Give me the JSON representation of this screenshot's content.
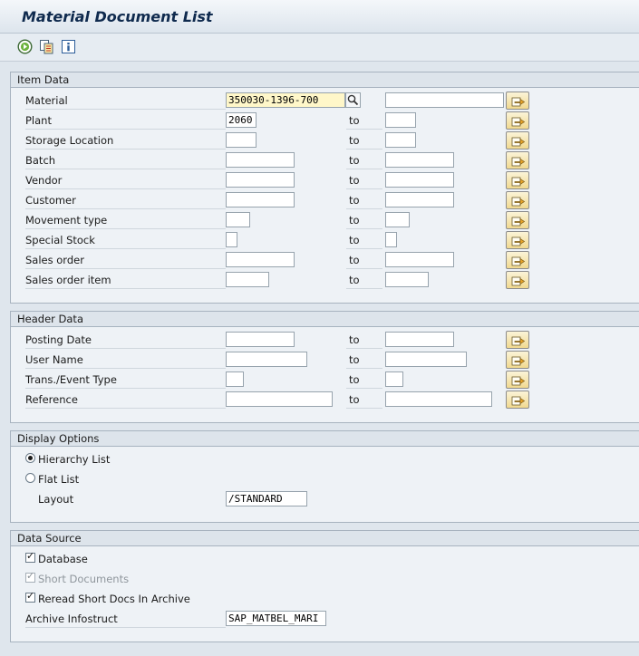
{
  "window": {
    "title": "Material Document List"
  },
  "toolbar": [
    {
      "name": "execute-icon"
    },
    {
      "name": "get-variant-icon"
    },
    {
      "name": "program-documentation-icon"
    }
  ],
  "item_data": {
    "title": "Item Data",
    "to_label": "to",
    "rows": [
      {
        "label": "Material",
        "from": "350030-1396-700",
        "to": ""
      },
      {
        "label": "Plant",
        "from": "2060",
        "to": ""
      },
      {
        "label": "Storage Location",
        "from": "",
        "to": ""
      },
      {
        "label": "Batch",
        "from": "",
        "to": ""
      },
      {
        "label": "Vendor",
        "from": "",
        "to": ""
      },
      {
        "label": "Customer",
        "from": "",
        "to": ""
      },
      {
        "label": "Movement type",
        "from": "",
        "to": ""
      },
      {
        "label": "Special Stock",
        "from": "",
        "to": ""
      },
      {
        "label": "Sales order",
        "from": "",
        "to": ""
      },
      {
        "label": "Sales order item",
        "from": "",
        "to": ""
      }
    ]
  },
  "header_data": {
    "title": "Header Data",
    "to_label": "to",
    "rows": [
      {
        "label": "Posting Date",
        "from": "",
        "to": ""
      },
      {
        "label": "User Name",
        "from": "",
        "to": ""
      },
      {
        "label": "Trans./Event Type",
        "from": "",
        "to": ""
      },
      {
        "label": "Reference",
        "from": "",
        "to": ""
      }
    ]
  },
  "display_options": {
    "title": "Display Options",
    "hierarchy_list": {
      "label": "Hierarchy List",
      "selected": true
    },
    "flat_list": {
      "label": "Flat List",
      "selected": false
    },
    "layout_label": "Layout",
    "layout_value": "/STANDARD"
  },
  "data_source": {
    "title": "Data Source",
    "database": {
      "label": "Database",
      "checked": true
    },
    "short_documents": {
      "label": "Short Documents",
      "checked": true,
      "disabled": true
    },
    "reread_archive": {
      "label": "Reread Short Docs In Archive",
      "checked": true
    },
    "archive_infostruct_label": "Archive Infostruct",
    "archive_infostruct_value": "SAP_MATBEL_MARI"
  },
  "colors": {
    "background": "#dfe6ed",
    "title_text": "#0f2a4e",
    "required_field": "#fff7c9",
    "multiselect_button": "#f1d98f"
  }
}
